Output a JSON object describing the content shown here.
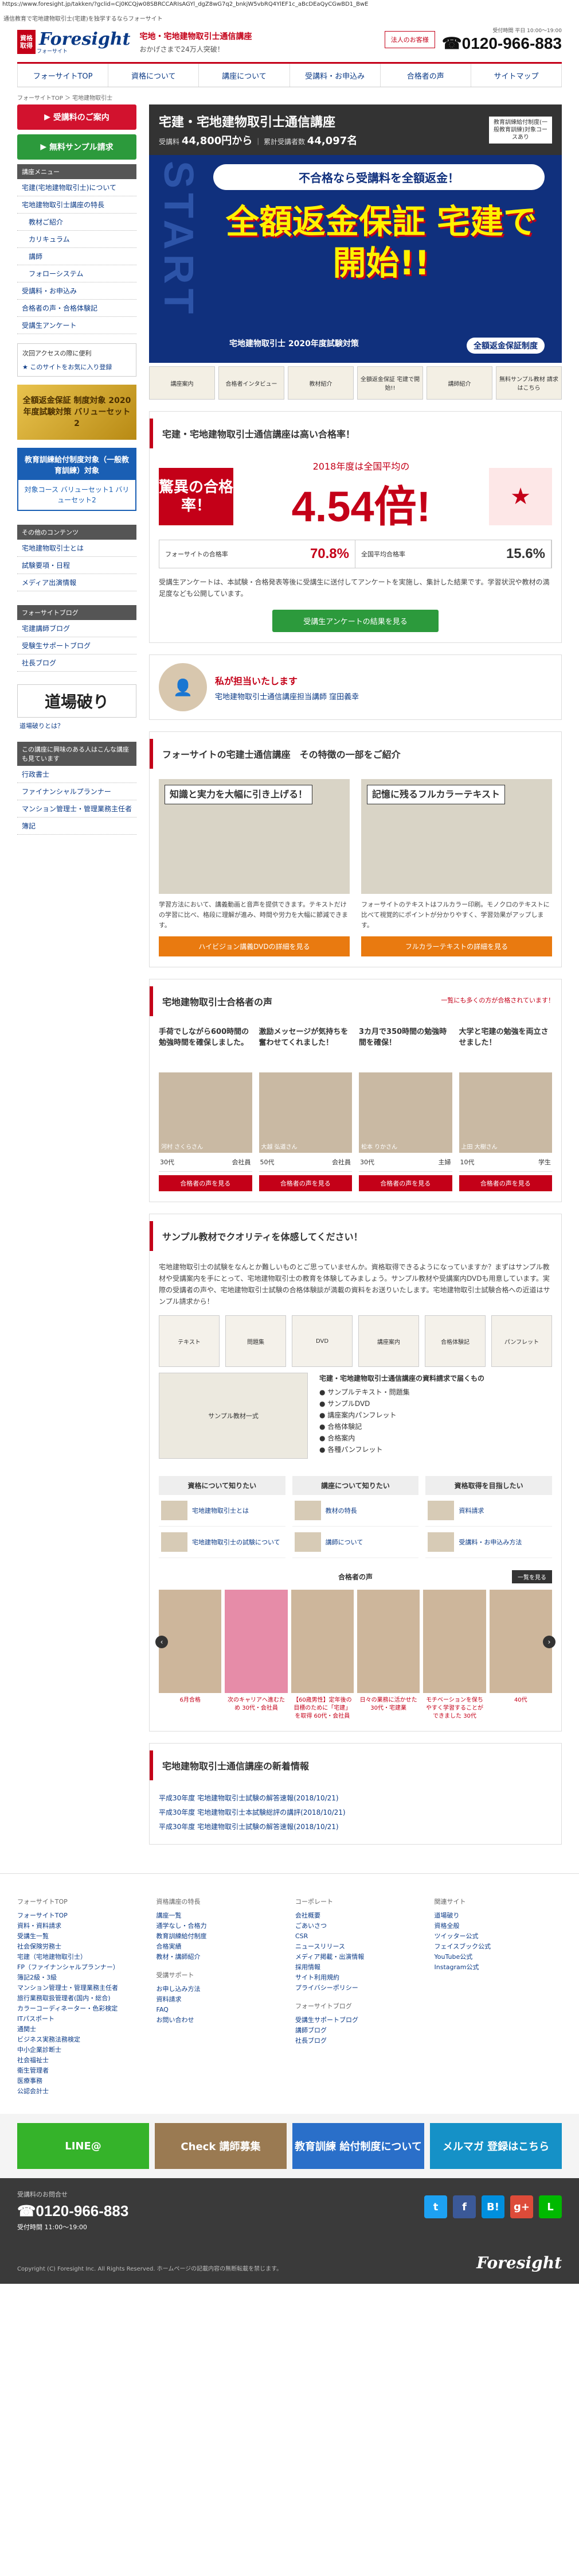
{
  "browser": {
    "url": "https://www.foresight.jp/takken/?gclid=Cj0KCQjw08SBRCCARIsAGYl_dgZ8wG7q2_bnkjW5vbRQ4YlEF1c_aBcDEaQyCGwBD1_BwE"
  },
  "page": {
    "tagline": "通信教育で宅地建物取引士(宅建)を独学するならフォーサイト"
  },
  "header": {
    "logo_box": "資格取得",
    "logo_text": "Foresight",
    "logo_sub": "フォーサイト",
    "title": "宅地・宅地建物取引士通信講座",
    "subtitle": "おかげさまで24万人突破！",
    "corp_link": "法人のお客様",
    "tel_note": "受付時間 平日 10:00〜19:00",
    "tel": "0120-966-883"
  },
  "gnav": [
    "フォーサイトTOP",
    "資格について",
    "講座について",
    "受講料・お申込み",
    "合格者の声",
    "サイトマップ"
  ],
  "breadcrumb": "フォーサイトTOP ＞ 宅地建物取引士",
  "sidebar": {
    "apply_button": "受講料のご案内",
    "sample_button": "無料サンプル請求",
    "menu_head": "講座メニュー",
    "menu_items": [
      {
        "label": "宅建(宅地建物取引士)について",
        "indent": false
      },
      {
        "label": "宅地建物取引士講座の特長",
        "indent": false
      },
      {
        "label": "教材ご紹介",
        "indent": true
      },
      {
        "label": "カリキュラム",
        "indent": true
      },
      {
        "label": "講師",
        "indent": true
      },
      {
        "label": "フォローシステム",
        "indent": true
      },
      {
        "label": "受講料・お申込み",
        "indent": false
      },
      {
        "label": "合格者の声・合格体験記",
        "indent": false
      },
      {
        "label": "受講生アンケート",
        "indent": false
      }
    ],
    "access_head": "次回アクセスの際に便利",
    "bookmark": "このサイトをお気に入り登録",
    "gold_banner": "全額返金保証 制度対象 2020年度試験対策 バリューセット2",
    "blue_head": "教育訓練給付制度対象（一般教育訓練）対象",
    "blue_body": "対象コース バリューセット1 バリューセット2",
    "other_head": "その他のコンテンツ",
    "other_items": [
      "宅地建物取引士とは",
      "試験要項・日程",
      "メディア出演情報"
    ],
    "blog_head": "フォーサイトブログ",
    "blog_items": [
      "宅建講師ブログ",
      "受験生サポートブログ",
      "社長ブログ"
    ],
    "dojo": "道場破り",
    "dojo_link": "道場破りとは？",
    "related_head": "この講座に興味のある人はこんな講座も見ています",
    "related_items": [
      "行政書士",
      "ファイナンシャルプランナー",
      "マンション管理士・管理業務主任者",
      "簿記"
    ]
  },
  "main": {
    "title": "宅建・宅地建物取引士通信講座",
    "fee_label": "受講料",
    "fee_value": "44,800円から",
    "students_label": "累計受講者数",
    "students_value": "44,097名",
    "title_note": "教育訓練給付制度(一般教育訓練)対象コースあり",
    "hero": {
      "start": "START",
      "banner": "不合格なら受講料を全額返金！",
      "big": "全額返金保証 宅建で開始!!",
      "sub_left": "宅地建物取引士 2020年度試験対策",
      "sub_right": "全額返金保証制度"
    },
    "thumbs": [
      "講座案内",
      "合格者インタビュー",
      "教材紹介",
      "全額返金保証 宅建で開始!!",
      "講師紹介",
      "無料サンプル教材 請求はこちら"
    ],
    "rate": {
      "head": "宅建・宅地建物取引士通信講座は高い合格率！",
      "left": "驚異の合格率！",
      "mid_small": "2018年度は全国平均の",
      "mid_big": "4.54倍!",
      "right": "★",
      "fs_label": "フォーサイトの合格率",
      "fs_value": "70.8%",
      "nat_label": "全国平均合格率",
      "nat_value": "15.6%",
      "desc": "受講生アンケートは、本試験・合格発表等後に受講生に送付してアンケートを実施し、集計した結果です。学習状況や教材の満足度なども公開しています。",
      "button": "受講生アンケートの結果を見る"
    },
    "charge": {
      "title": "私が担当いたします",
      "name": "宅地建物取引士通信講座担当講師 窪田義幸"
    },
    "features": {
      "head": "フォーサイトの宅建士通信講座　その特徴の一部をご紹介",
      "items": [
        {
          "overlay": "知識と実力を大幅に引き上げる！",
          "text": "学習方法において、講義動画と音声を提供できます。テキストだけの学習に比べ、格段に理解が進み、時間や労力を大幅に節減できます。",
          "button": "ハイビジョン講義DVDの詳細を見る"
        },
        {
          "overlay": "記憶に残るフルカラーテキスト",
          "text": "フォーサイトのテキストはフルカラー印刷。モノクロのテキストに比べて視覚的にポイントが分かりやすく、学習効果がアップします。",
          "button": "フルカラーテキストの詳細を見る"
        }
      ]
    },
    "voices": {
      "head": "宅地建物取引士合格者の声",
      "more": "一覧にも多くの方が合格されています！",
      "items": [
        {
          "quote": "手荷でしながら600時間の勉強時間を確保しました。",
          "name": "河村 さくらさん",
          "meta1": "30代",
          "meta2": "会社員",
          "button": "合格者の声を見る"
        },
        {
          "quote": "激励メッセージが気持ちを奮わせてくれました！",
          "name": "大越 弘道さん",
          "meta1": "50代",
          "meta2": "会社員",
          "button": "合格者の声を見る"
        },
        {
          "quote": "3カ月で350時間の勉強時間を確保！",
          "name": "松本 りかさん",
          "meta1": "30代",
          "meta2": "主婦",
          "button": "合格者の声を見る"
        },
        {
          "quote": "大学と宅建の勉強を両立させました！",
          "name": "上田 大樹さん",
          "meta1": "10代",
          "meta2": "学生",
          "button": "合格者の声を見る"
        }
      ]
    },
    "sample": {
      "head": "サンプル教材でクオリティを体感してください！",
      "desc": "宅地建物取引士の試験をなんとか難しいものとご思っていませんか。資格取得できるようになっていますか？まずはサンプル教材や受講案内を手にとって、宅地建物取引士の教育を体験してみましょう。サンプル教材や受講案内DVDも用意しています。実際の受講者の声や、宅地建物取引士試験の合格体験談が満載の資料をお送りいたします。宅地建物取引士試験合格への近道はサンプル請求から！",
      "imgs": [
        "テキスト",
        "問題集",
        "DVD",
        "講座案内",
        "合格体験記",
        "パンフレット"
      ],
      "pic": "サンプル教材一式",
      "list_head": "宅建・宅地建物取引士通信講座の資料請求で届くもの",
      "list_items": [
        "サンプルテキスト・問題集",
        "サンプルDVD",
        "講座案内パンフレット",
        "合格体験記",
        "合格案内",
        "各種パンフレット"
      ],
      "cats": [
        {
          "head": "資格について知りたい",
          "rows": [
            "宅地建物取引士とは",
            "宅地建物取引士の試験について"
          ]
        },
        {
          "head": "講座について知りたい",
          "rows": [
            "教材の特長",
            "講師について"
          ]
        },
        {
          "head": "資格取得を目指したい",
          "rows": [
            "資料請求",
            "受講料・お申込み方法"
          ]
        }
      ],
      "pass_head": "合格者の声",
      "pass_list": "一覧を見る",
      "captions": [
        "6月合格",
        "次のキャリアへ進むため 30代・会社員",
        "【60歳男性】定年後の目標のために「宅建」を取得 60代・会社員",
        "日々の業務に活かせた 30代・宅建業",
        "モチベーションを保ちやすく学習することができました 30代",
        "40代"
      ]
    },
    "news": {
      "head": "宅地建物取引士通信講座の新着情報",
      "items": [
        "平成30年度 宅地建物取引士試験の解答速報(2018/10/21)",
        "平成30年度 宅地建物取引士本試験総評の講評(2018/10/21)",
        "平成30年度 宅地建物取引士試験の解答速報(2018/10/21)"
      ]
    }
  },
  "footer": {
    "cols": [
      {
        "head": "フォーサイトTOP",
        "groups": [
          {
            "links": [
              "フォーサイトTOP",
              "資料・資料請求"
            ]
          },
          {
            "links": [
              "受講生一覧",
              "社会保険労務士",
              "宅建（宅地建物取引士）",
              "FP（ファイナンシャルプランナー）",
              "簿記2級・3級",
              "マンション管理士・管理業務主任者",
              "旅行業務取扱管理者(国内・総合)",
              "カラーコーディネーター・色彩検定",
              "ITパスポート",
              "通関士",
              "ビジネス実務法務検定",
              "中小企業診断士",
              "社会福祉士",
              "衛生管理者",
              "医療事務",
              "公認会計士"
            ]
          }
        ]
      },
      {
        "head": "資格講座の特長",
        "groups": [
          {
            "links": [
              "講座一覧",
              "通学なし・合格力",
              "教育訓練給付制度",
              "合格実績",
              "教材・講師紹介"
            ]
          },
          {
            "head": "受講サポート",
            "links": [
              "お申し込み方法",
              "資料請求",
              "FAQ",
              "お問い合わせ"
            ]
          }
        ]
      },
      {
        "head": "コーポレート",
        "groups": [
          {
            "links": [
              "会社概要",
              "ごあいさつ",
              "CSR",
              "ニュースリリース",
              "メディア掲載・出演情報",
              "採用情報",
              "サイト利用規約",
              "プライバシーポリシー"
            ]
          },
          {
            "head": "フォーサイトブログ",
            "links": [
              "受講生サポートブログ",
              "講師ブログ",
              "社長ブログ"
            ]
          }
        ]
      },
      {
        "head": "関連サイト",
        "groups": [
          {
            "links": [
              "道場破り",
              "資格全般",
              "ツイッター公式",
              "フェイスブック公式",
              "YouTube公式",
              "Instagram公式"
            ]
          }
        ]
      }
    ],
    "banners": [
      "LINE@",
      "Check 講師募集",
      "教育訓練 給付制度について",
      "メルマガ 登録はこちら"
    ],
    "inquiry": "受講料のお問合せ",
    "tel": "0120-966-883",
    "hours": "受付時間 11:00〜19:00",
    "copyright": "Copyright (C) Foresight Inc. All Rights Reserved. ホームページの記載内容の無断転載を禁じます。",
    "social": [
      {
        "icon": "twitter-icon",
        "label": "t",
        "color": "#1da1f2"
      },
      {
        "icon": "facebook-icon",
        "label": "f",
        "color": "#3b5998"
      },
      {
        "icon": "hatena-icon",
        "label": "B!",
        "color": "#008fde"
      },
      {
        "icon": "google-plus-icon",
        "label": "g+",
        "color": "#dd4b39"
      },
      {
        "icon": "line-icon",
        "label": "L",
        "color": "#00b900"
      }
    ],
    "logo": "Foresight"
  }
}
